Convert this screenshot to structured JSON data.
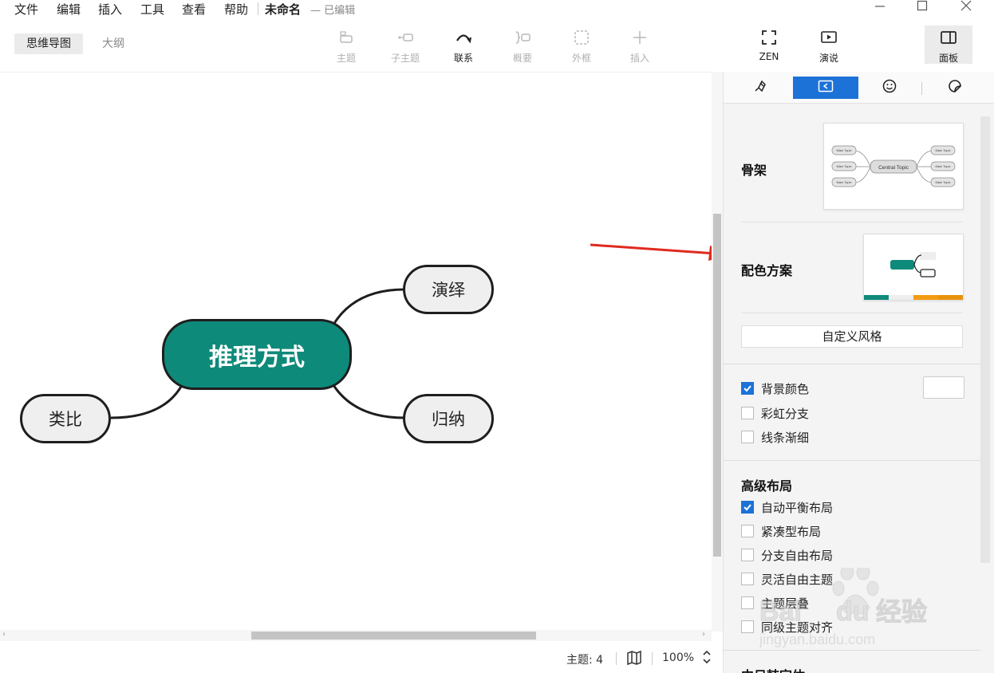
{
  "menu": {
    "items": [
      "文件",
      "编辑",
      "插入",
      "工具",
      "查看",
      "帮助"
    ],
    "doc_title": "未命名",
    "doc_status": "— 已编辑"
  },
  "window_controls": [
    "minimize-icon",
    "maximize-icon",
    "close-icon"
  ],
  "toolbar": {
    "view_tabs": [
      "思维导图",
      "大纲"
    ],
    "active_view": "思维导图",
    "tools": [
      {
        "label": "主题",
        "icon": "topic-icon",
        "enabled": false
      },
      {
        "label": "子主题",
        "icon": "subtopic-icon",
        "enabled": false
      },
      {
        "label": "联系",
        "icon": "relationship-icon",
        "enabled": true
      },
      {
        "label": "概要",
        "icon": "summary-icon",
        "enabled": false
      },
      {
        "label": "外框",
        "icon": "boundary-icon",
        "enabled": false
      },
      {
        "label": "插入",
        "icon": "plus-icon",
        "enabled": false
      }
    ],
    "right_tools": [
      {
        "label": "ZEN",
        "icon": "fullscreen-icon"
      },
      {
        "label": "演说",
        "icon": "play-icon"
      },
      {
        "label": "面板",
        "icon": "panel-icon"
      }
    ]
  },
  "mindmap": {
    "central": "推理方式",
    "central_color": "#0e8a7a",
    "branches": [
      "演绎",
      "归纳",
      "类比"
    ]
  },
  "status_bar": {
    "topic_count": "主题: 4",
    "zoom": "100%"
  },
  "panel": {
    "tabs": [
      "brush-icon",
      "style-icon",
      "emoji-icon",
      "sticker-icon"
    ],
    "active_tab": "style-icon",
    "skeleton_label": "骨架",
    "skeleton_preview": {
      "central": "Central Topic",
      "main": "Main Topic"
    },
    "color_scheme_label": "配色方案",
    "color_scheme_colors": [
      "#0e8a7a",
      "#eeeeee",
      "#f39c12",
      "#e8930c"
    ],
    "custom_style_button": "自定义风格",
    "options": [
      {
        "label": "背景颜色",
        "checked": true
      },
      {
        "label": "彩虹分支",
        "checked": false
      },
      {
        "label": "线条渐细",
        "checked": false
      }
    ],
    "advanced_layout_title": "高级布局",
    "layout_options": [
      {
        "label": "自动平衡布局",
        "checked": true
      },
      {
        "label": "紧凑型布局",
        "checked": false
      },
      {
        "label": "分支自由布局",
        "checked": false
      },
      {
        "label": "灵活自由主题",
        "checked": false
      },
      {
        "label": "主题层叠",
        "checked": false
      },
      {
        "label": "同级主题对齐",
        "checked": false
      }
    ],
    "cjk_font_title": "中日韩字体"
  },
  "watermark": {
    "brand": "Bai du 经验",
    "url": "jingyan.baidu.com"
  },
  "accent_color": "#1c72d6",
  "annotation_arrow_color": "#e02a1f"
}
